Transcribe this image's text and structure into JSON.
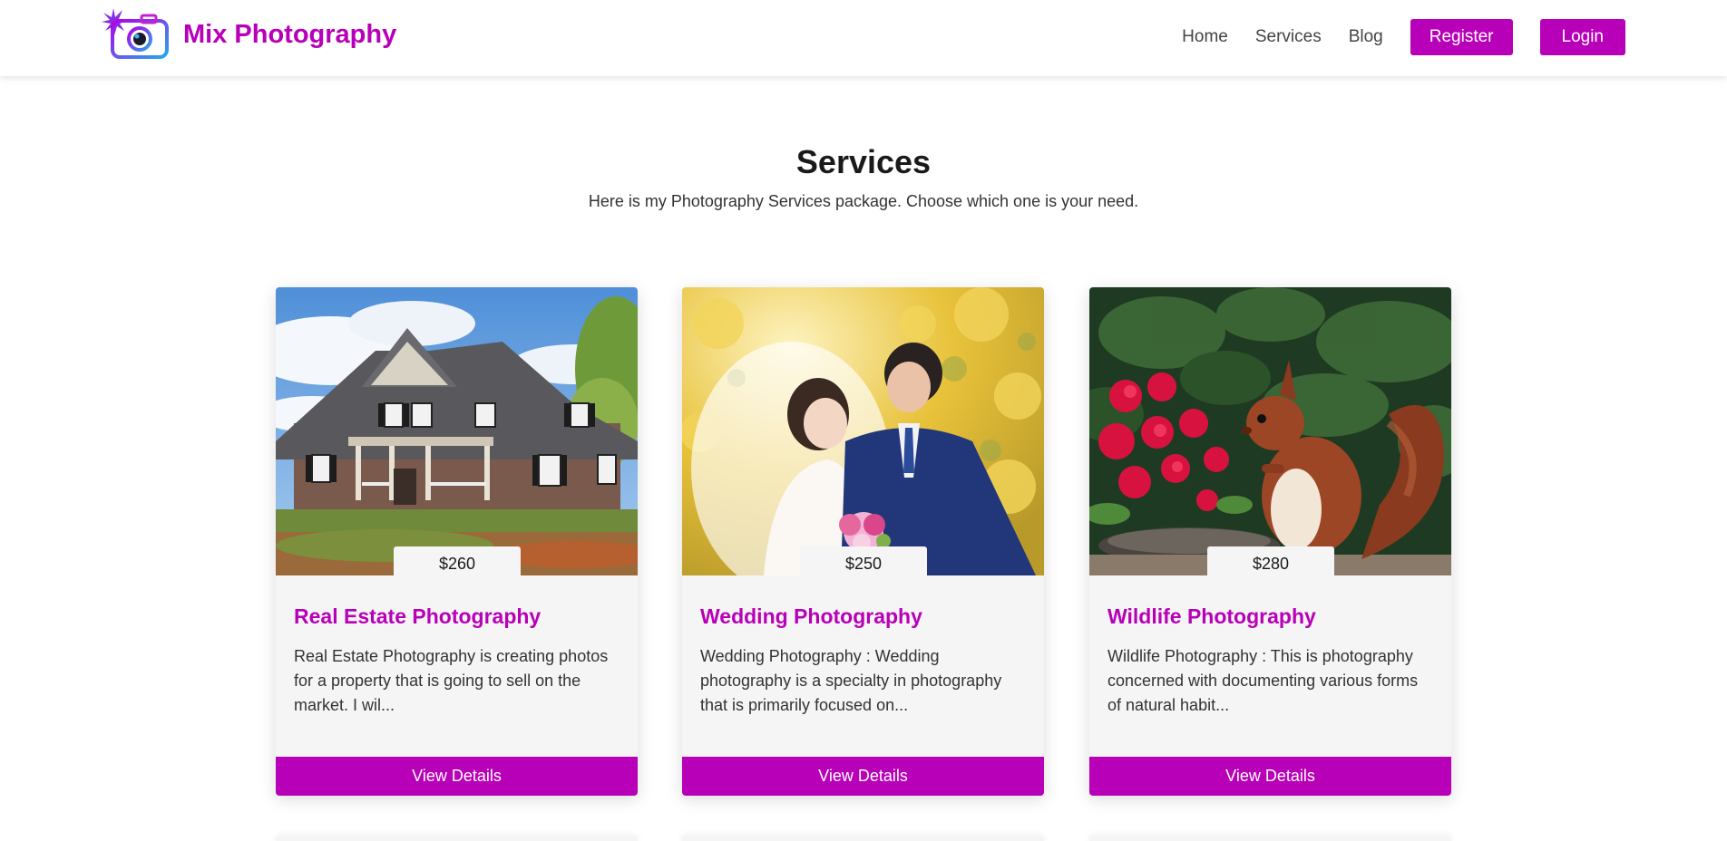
{
  "brand": {
    "name": "Mix Photography",
    "logo_icon": "camera-icon",
    "accent_color": "#b800b8"
  },
  "nav": {
    "links": [
      "Home",
      "Services",
      "Blog"
    ],
    "register_label": "Register",
    "login_label": "Login"
  },
  "header": {
    "title": "Services",
    "subtitle": "Here is my Photography Services package. Choose which one is your need."
  },
  "services": [
    {
      "price": "$260",
      "title": "Real Estate Photography",
      "description": "Real Estate Photography is creating photos for a property that is going to sell on the market. I wil...",
      "button_label": "View Details",
      "image": "house-photo"
    },
    {
      "price": "$250",
      "title": "Wedding Photography",
      "description": "Wedding Photography : Wedding photography is a specialty in photography that is primarily focused on...",
      "button_label": "View Details",
      "image": "wedding-couple-photo"
    },
    {
      "price": "$280",
      "title": "Wildlife Photography",
      "description": "Wildlife Photography : This is photography concerned with documenting various forms of natural habit...",
      "button_label": "View Details",
      "image": "squirrel-photo"
    }
  ]
}
